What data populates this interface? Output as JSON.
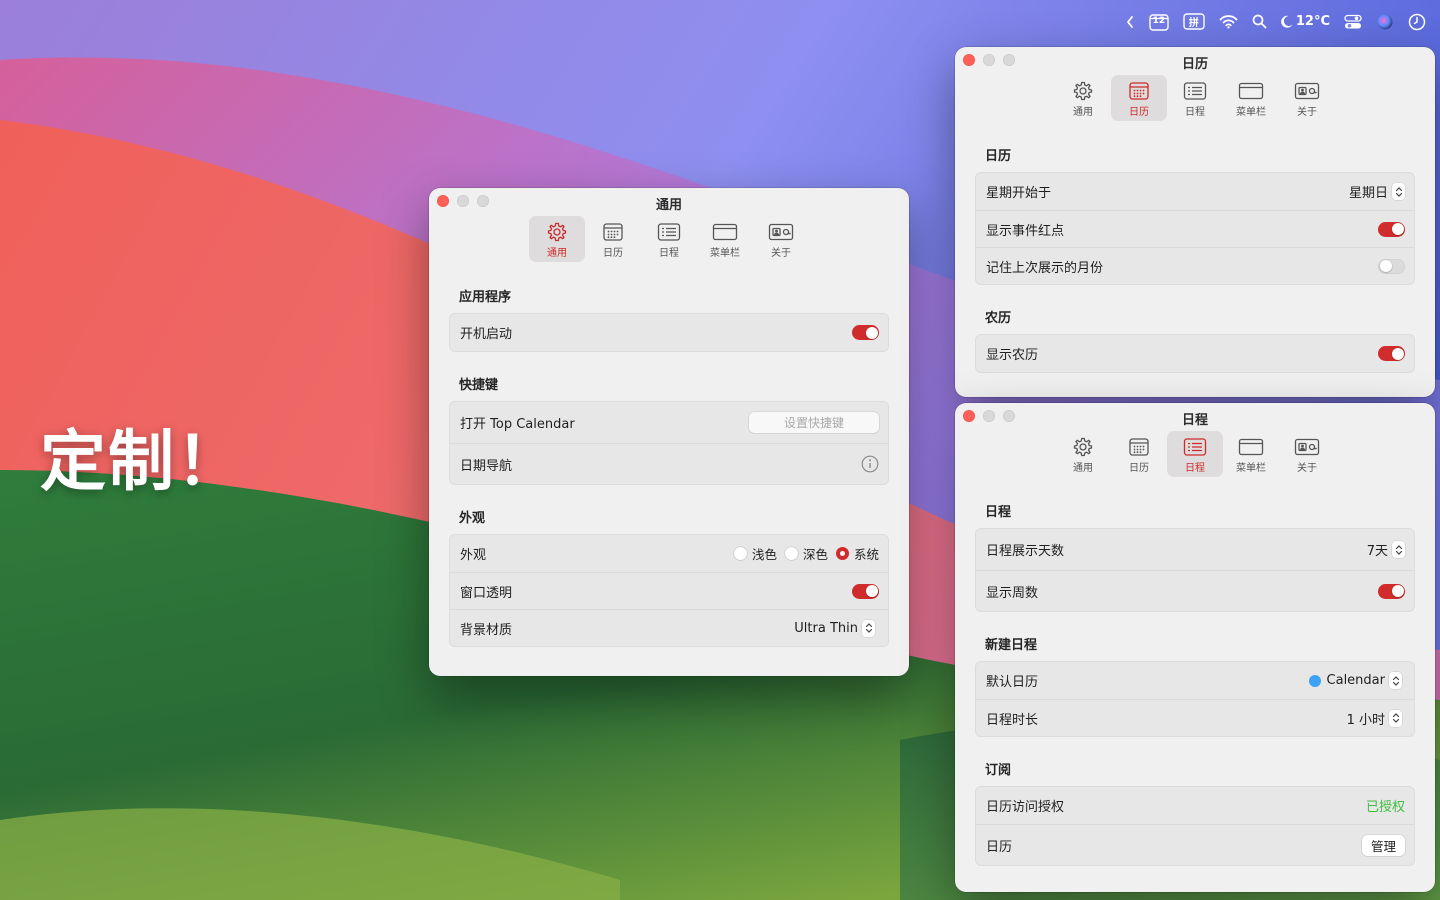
{
  "promo_text": "定制！",
  "menubar": {
    "calendar_day": "12",
    "input_method": "拼",
    "weather": "12°C"
  },
  "colors": {
    "accent": "#d02c2c",
    "calendar_dot": "#3ea2f5",
    "granted": "#3fbd3f"
  },
  "toolbar_labels": [
    "通用",
    "日历",
    "日程",
    "菜单栏",
    "关于"
  ],
  "general_window": {
    "title": "通用",
    "sections": {
      "app": {
        "title": "应用程序",
        "launch_at_login": {
          "label": "开机启动",
          "on": true
        }
      },
      "shortcuts": {
        "title": "快捷键",
        "open_label": "打开 Top Calendar",
        "set_shortcut_button": "设置快捷键",
        "date_nav_label": "日期导航"
      },
      "appearance": {
        "title": "外观",
        "appearance_label": "外观",
        "options": [
          "浅色",
          "深色",
          "系统"
        ],
        "selected": "系统",
        "transparency": {
          "label": "窗口透明",
          "on": true
        },
        "material": {
          "label": "背景材质",
          "value": "Ultra Thin"
        }
      }
    }
  },
  "calendar_window": {
    "title": "日历",
    "sections": {
      "calendar": {
        "title": "日历",
        "week_start": {
          "label": "星期开始于",
          "value": "星期日"
        },
        "event_dot": {
          "label": "显示事件红点",
          "on": true
        },
        "remember_month": {
          "label": "记住上次展示的月份",
          "on": false
        }
      },
      "lunar": {
        "title": "农历",
        "show_lunar": {
          "label": "显示农历",
          "on": true
        }
      }
    }
  },
  "schedule_window": {
    "title": "日程",
    "sections": {
      "schedule": {
        "title": "日程",
        "days": {
          "label": "日程展示天数",
          "value": "7天"
        },
        "week_numbers": {
          "label": "显示周数",
          "on": true
        }
      },
      "new_event": {
        "title": "新建日程",
        "default_calendar": {
          "label": "默认日历",
          "value": "Calendar"
        },
        "duration": {
          "label": "日程时长",
          "value": "1 小时"
        }
      },
      "subscription": {
        "title": "订阅",
        "access": {
          "label": "日历访问授权",
          "value": "已授权"
        },
        "calendars": {
          "label": "日历",
          "button": "管理"
        }
      }
    }
  }
}
